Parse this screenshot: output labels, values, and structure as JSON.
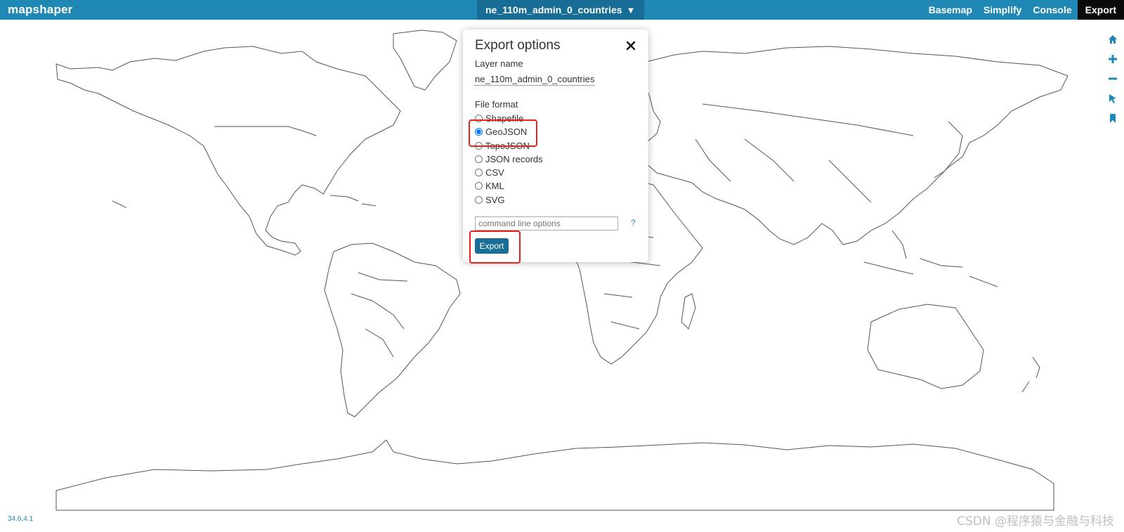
{
  "app": {
    "logo": "mapshaper",
    "layer_button_label": "ne_110m_admin_0_countries",
    "layer_button_arrow": "▼"
  },
  "nav": {
    "items": [
      "Basemap",
      "Simplify",
      "Console",
      "Export"
    ],
    "active": "Export"
  },
  "export_dialog": {
    "title": "Export options",
    "layer_name_label": "Layer name",
    "layer_name_value": "ne_110m_admin_0_countries",
    "file_format_label": "File format",
    "formats": [
      "Shapefile",
      "GeoJSON",
      "TopoJSON",
      "JSON records",
      "CSV",
      "KML",
      "SVG"
    ],
    "selected_format": "GeoJSON",
    "cmd_placeholder": "command line options",
    "help_label": "?",
    "export_button_label": "Export"
  },
  "status": {
    "coordinates": "34.6,4.1"
  },
  "watermark": "CSDN @程序猿与金融与科技",
  "colors": {
    "header_bar": "#1f88b5",
    "accent_dark": "#176d95",
    "highlight_box": "#e6231d",
    "map_outline": "#555555"
  },
  "tools": [
    "home-icon",
    "zoom-in-icon",
    "zoom-out-icon",
    "pointer-icon",
    "bookmark-icon"
  ]
}
